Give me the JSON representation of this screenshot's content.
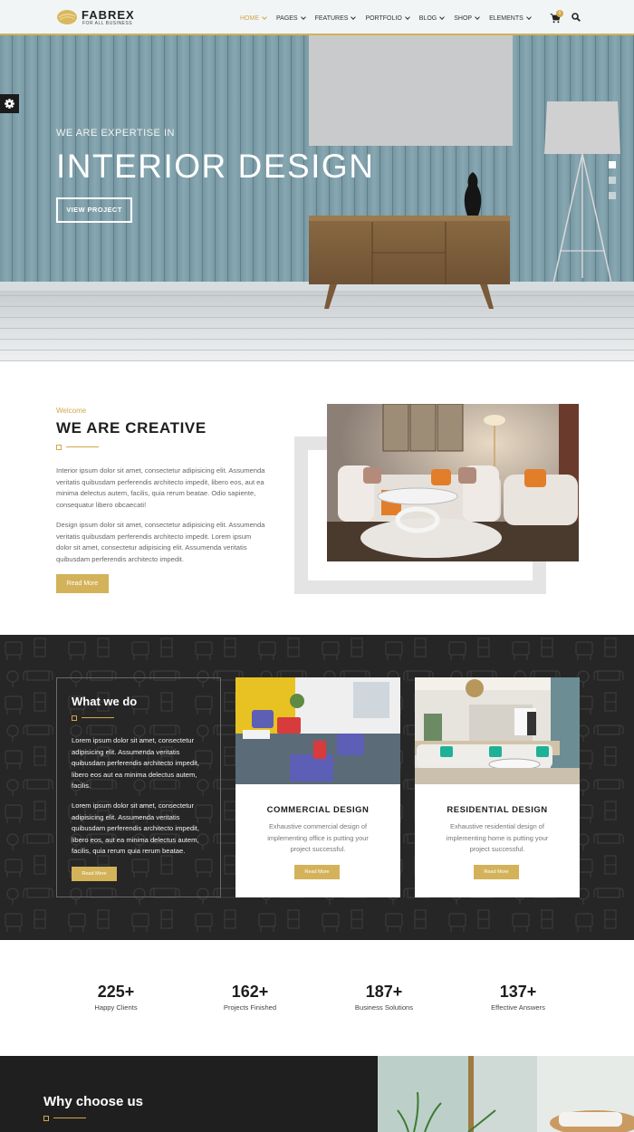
{
  "brand": {
    "name": "FABREX",
    "tagline": "FOR ALL BUSINESS",
    "accent": "#d3a64a"
  },
  "nav": {
    "items": [
      {
        "label": "HOME",
        "active": true
      },
      {
        "label": "PAGES",
        "active": false
      },
      {
        "label": "FEATURES",
        "active": false
      },
      {
        "label": "PORTFOLIO",
        "active": false
      },
      {
        "label": "BLOG",
        "active": false
      },
      {
        "label": "SHOP",
        "active": false
      },
      {
        "label": "ELEMENTS",
        "active": false
      }
    ],
    "cart_count": "0",
    "cart_icon": "cart-icon",
    "search_icon": "search-icon"
  },
  "hero": {
    "subtitle": "WE ARE EXPERTISE IN",
    "title": "INTERIOR DESIGN",
    "button": "VIEW PROJECT",
    "slide_count": 3,
    "active_slide": 1
  },
  "about": {
    "eyebrow": "Welcome",
    "title": "WE ARE CREATIVE",
    "paragraph_1": "Interior ipsum dolor sit amet, consectetur adipisicing elit. Assumenda veritatis quibusdam perferendis architecto impedit, libero eos, aut ea minima delectus autem, facilis, quia rerum beatae. Odio sapiente, consequatur libero obcaecati!",
    "paragraph_2": "Design ipsum dolor sit amet, consectetur adipisicing elit. Assumenda veritatis quibusdam perferendis architecto impedit. Lorem ipsum dolor sit amet, consectetur adipisicing elit. Assumenda veritatis quibusdam perferendis architecto impedit.",
    "button": "Read More"
  },
  "services": {
    "title": "What we do",
    "paragraph_1": "Lorem ipsum dolor sit amet, consectetur adipisicing elit. Assumenda veritatis quibusdam perferendis architecto impedit, libero eos aut ea minima delectus autem, facilis.",
    "paragraph_2": "Lorem ipsum dolor sit amet, consectetur adipisicing elit. Assumenda veritatis quibusdam perferendis architecto impedit, libero eos, aut ea minima delectus autem, facilis, quia rerum quia rerum beatae.",
    "button": "Read More",
    "cards": [
      {
        "title": "COMMERCIAL DESIGN",
        "desc": "Exhaustive commercial design of implementing office is putting your project successful.",
        "button": "Read More"
      },
      {
        "title": "RESIDENTIAL DESIGN",
        "desc": "Exhaustive residential design of implementing home is putting your project successful.",
        "button": "Read More"
      }
    ]
  },
  "stats": [
    {
      "value": "225+",
      "label": "Happy Clients"
    },
    {
      "value": "162+",
      "label": "Projects Finished"
    },
    {
      "value": "187+",
      "label": "Business Solutions"
    },
    {
      "value": "137+",
      "label": "Effective Answers"
    }
  ],
  "why": {
    "title": "Why choose us"
  }
}
